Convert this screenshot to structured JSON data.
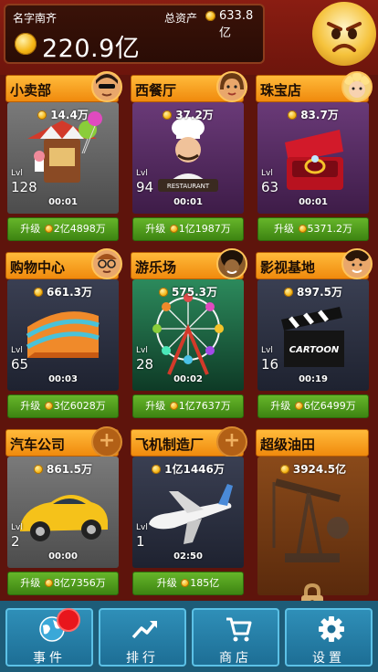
{
  "header": {
    "player_name": "名字南齐",
    "total_assets_label": "总资产",
    "total_assets_value": "633.8亿",
    "cash": "220.9亿",
    "mood_icon": "angry-face-icon"
  },
  "businesses": [
    {
      "title": "小卖部",
      "income": "14.4万",
      "level_label": "Lvl",
      "level": "128",
      "timer": "00:01",
      "upgrade_label": "升级",
      "upgrade_cost": "2亿4898万",
      "manager": "sunglasses-man-avatar"
    },
    {
      "title": "西餐厅",
      "income": "37.2万",
      "level_label": "Lvl",
      "level": "94",
      "timer": "00:01",
      "upgrade_label": "升级",
      "upgrade_cost": "1亿1987万",
      "manager": "woman-avatar",
      "sign": "RESTAURANT"
    },
    {
      "title": "珠宝店",
      "income": "83.7万",
      "level_label": "Lvl",
      "level": "63",
      "timer": "00:01",
      "upgrade_label": "升级",
      "upgrade_cost": "5371.2万",
      "manager": "blonde-woman-avatar"
    },
    {
      "title": "购物中心",
      "income": "661.3万",
      "level_label": "Lvl",
      "level": "65",
      "timer": "00:03",
      "upgrade_label": "升级",
      "upgrade_cost": "3亿6028万",
      "manager": "glasses-man-avatar"
    },
    {
      "title": "游乐场",
      "income": "575.3万",
      "level_label": "Lvl",
      "level": "28",
      "timer": "00:02",
      "upgrade_label": "升级",
      "upgrade_cost": "1亿7637万",
      "manager": "afro-man-avatar"
    },
    {
      "title": "影视基地",
      "income": "897.5万",
      "level_label": "Lvl",
      "level": "16",
      "timer": "00:19",
      "upgrade_label": "升级",
      "upgrade_cost": "6亿6499万",
      "manager": "curly-man-avatar",
      "sign": "CARTOON"
    },
    {
      "title": "汽车公司",
      "income": "861.5万",
      "level_label": "Lvl",
      "level": "2",
      "timer": "00:00",
      "upgrade_label": "升级",
      "upgrade_cost": "8亿7356万",
      "manager": "empty-slot"
    },
    {
      "title": "飞机制造厂",
      "income": "1亿1446万",
      "level_label": "Lvl",
      "level": "1",
      "timer": "02:50",
      "upgrade_label": "升级",
      "upgrade_cost": "185亿",
      "manager": "empty-slot"
    },
    {
      "title": "超级油田",
      "income": "3924.5亿",
      "locked": true
    }
  ],
  "nav": [
    {
      "label": "事件",
      "icon": "globe-icon",
      "badge": true
    },
    {
      "label": "排行",
      "icon": "trend-chart-icon"
    },
    {
      "label": "商店",
      "icon": "shopping-cart-icon"
    },
    {
      "label": "设置",
      "icon": "gear-icon"
    }
  ],
  "colors": {
    "background": "#5e140c",
    "card_header": "#f5a020",
    "upgrade_button": "#4f9e1d",
    "nav_bar": "#2a86b0"
  }
}
